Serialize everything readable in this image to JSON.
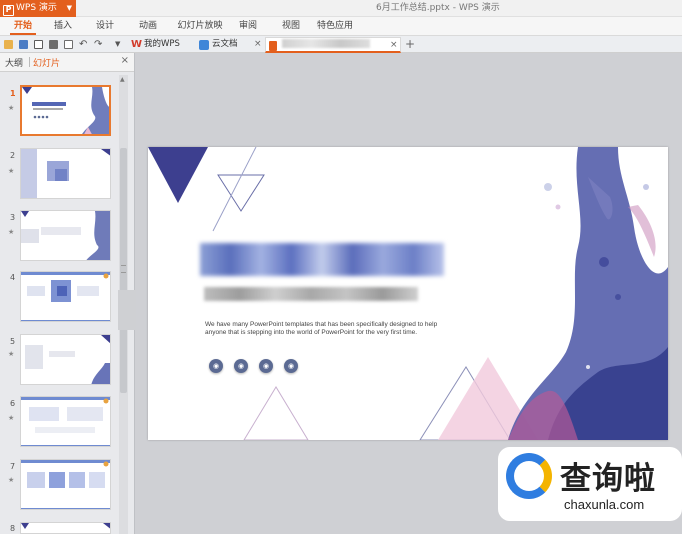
{
  "titlebar": {
    "app_label": "WPS 演示",
    "doc_title": "6月工作总结.pptx - WPS 演示"
  },
  "menu": {
    "tabs": [
      {
        "label": "开始",
        "active": true
      },
      {
        "label": "插入"
      },
      {
        "label": "设计"
      },
      {
        "label": "动画"
      },
      {
        "label": "幻灯片放映"
      },
      {
        "label": "审阅"
      },
      {
        "label": "视图"
      },
      {
        "label": "特色应用"
      }
    ]
  },
  "doc_tabs": {
    "wps_label": "我的WPS",
    "cloud_label": "云文档",
    "close_glyph": "×",
    "add_glyph": "+"
  },
  "side_panel": {
    "outline_tab": "大纲",
    "slides_tab": "幻灯片",
    "close_glyph": "×",
    "slide_numbers": [
      "1",
      "2",
      "3",
      "4",
      "5",
      "6",
      "7",
      "8"
    ],
    "star_glyph": "★",
    "thumb1_title": "6月工作总结",
    "thumb1_sub": "WORK REPORT FOR JUNE"
  },
  "slide": {
    "body_text": "We have many PowerPoint templates that has been specifically designed to help anyone that is stepping into the world of PowerPoint for the very first time."
  },
  "watermark": {
    "text": "查询啦",
    "url": "chaxunla.com"
  },
  "colors": {
    "accent": "#e35f1d",
    "slide_indigo": "#3d3f8f"
  }
}
